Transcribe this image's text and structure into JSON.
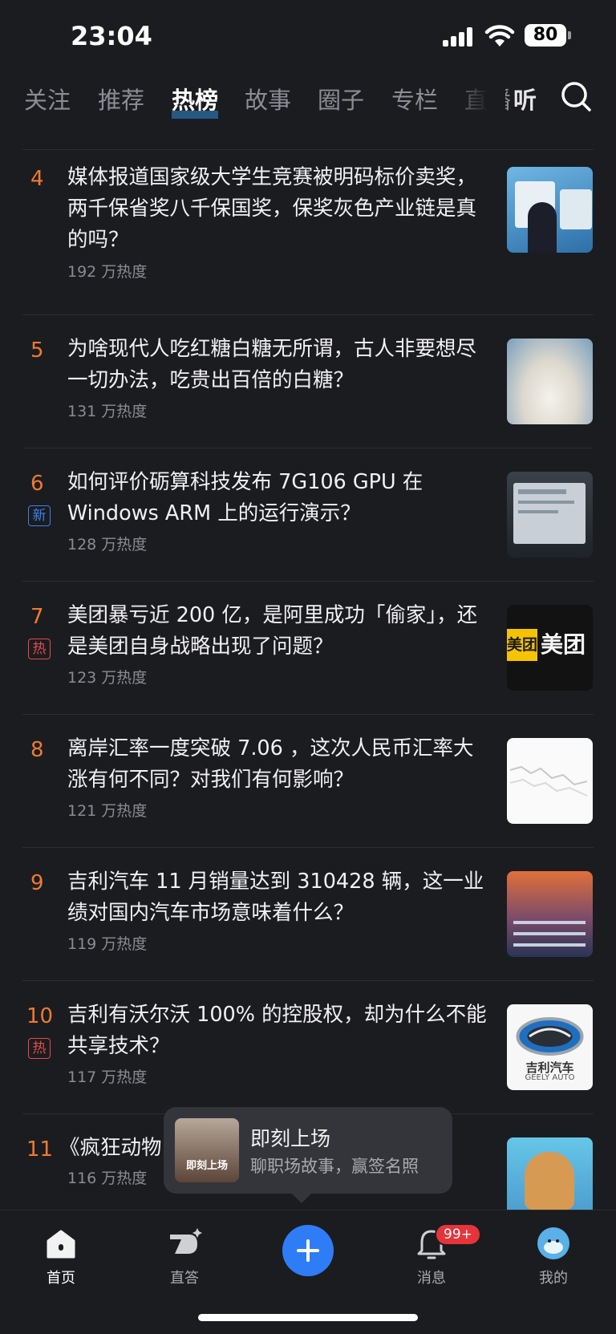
{
  "status": {
    "time": "23:04",
    "battery": "80"
  },
  "tabs": [
    "关注",
    "推荐",
    "热榜",
    "故事",
    "圈子",
    "专栏",
    "直播"
  ],
  "listen_label": "听",
  "items": [
    {
      "rank": "4",
      "title": "媒体报道国家级大学生竞赛被明码标价卖奖，两千保省奖八千保国奖，保奖灰色产业链是真的吗？",
      "heat": "192 万热度",
      "tag": ""
    },
    {
      "rank": "5",
      "title": "为啥现代人吃红糖白糖无所谓，古人非要想尽一切办法，吃贵出百倍的白糖？",
      "heat": "131 万热度",
      "tag": ""
    },
    {
      "rank": "6",
      "title": "如何评价砺算科技发布 7G106 GPU 在 Windows ARM 上的运行演示？",
      "heat": "128 万热度",
      "tag": "新"
    },
    {
      "rank": "7",
      "title": "美团暴亏近 200 亿，是阿里成功「偷家」，还是美团自身战略出现了问题？",
      "heat": "123 万热度",
      "tag": "热"
    },
    {
      "rank": "8",
      "title": "离岸汇率一度突破 7.06 ，这次人民币汇率大涨有何不同？对我们有何影响？",
      "heat": "121 万热度",
      "tag": ""
    },
    {
      "rank": "9",
      "title": "吉利汽车 11 月销量达到 310428 辆，这一业绩对国内汽车市场意味着什么？",
      "heat": "119 万热度",
      "tag": ""
    },
    {
      "rank": "10",
      "title": "吉利有沃尔沃 100% 的控股权，却为什么不能共享技术？",
      "heat": "117 万热度",
      "tag": "热"
    },
    {
      "rank": "11",
      "title": "《疯狂动物",
      "heat": "116 万热度",
      "tag": ""
    }
  ],
  "thumbs": {
    "meituan_text": "美团",
    "geely_cn": "吉利汽车",
    "geely_en": "GEELY AUTO"
  },
  "popup": {
    "title": "即刻上场",
    "subtitle": "聊职场故事，赢签名照",
    "image_text": "即刻上场"
  },
  "nav": {
    "home": "首页",
    "zhida": "直答",
    "messages": "消息",
    "me": "我的",
    "badge": "99+"
  },
  "colors": {
    "accent": "#2f7df6",
    "rank": "#f07a30",
    "hot_tag": "#e24d4a",
    "new_tag": "#3d7ff0"
  }
}
